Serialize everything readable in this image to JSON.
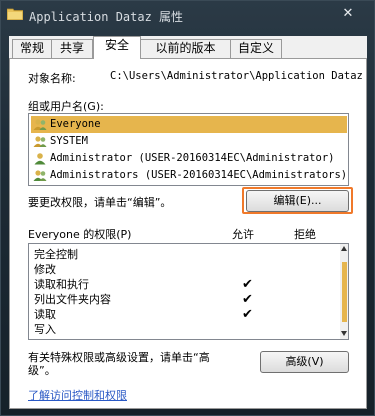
{
  "window": {
    "title": "Application Dataz 属性",
    "close_label": "✕"
  },
  "tabs": [
    {
      "label": "常规",
      "active": false
    },
    {
      "label": "共享",
      "active": false
    },
    {
      "label": "安全",
      "active": true
    },
    {
      "label": "以前的版本",
      "active": false
    },
    {
      "label": "自定义",
      "active": false
    }
  ],
  "security": {
    "object_label": "对象名称:",
    "object_value": "C:\\Users\\Administrator\\Application Dataz",
    "group_label": "组或用户名(G):",
    "users": [
      {
        "name": "Everyone",
        "selected": true
      },
      {
        "name": "SYSTEM",
        "selected": false
      },
      {
        "name": "Administrator (USER-20160314EC\\Administrator)",
        "selected": false
      },
      {
        "name": "Administrators (USER-20160314EC\\Administrators)",
        "selected": false
      }
    ],
    "change_text": "要更改权限，请单击“编辑”。",
    "edit_button": "编辑(E)...",
    "perm_header": "Everyone 的权限(P)",
    "allow_header": "允许",
    "deny_header": "拒绝",
    "permissions": [
      {
        "name": "完全控制",
        "allow": ""
      },
      {
        "name": "修改",
        "allow": ""
      },
      {
        "name": "读取和执行",
        "allow": "✔"
      },
      {
        "name": "列出文件夹内容",
        "allow": "✔"
      },
      {
        "name": "读取",
        "allow": "✔"
      },
      {
        "name": "写入",
        "allow": ""
      }
    ],
    "special_text_1": "有关特殊权限或高级设置，请单击“高",
    "special_text_2": "级”。",
    "advanced_button": "高级(V)",
    "link_text": "了解访问控制和权限"
  },
  "colors": {
    "selection": "#e6b54d",
    "highlight_border": "#f0792a",
    "link": "#2a59c5"
  }
}
